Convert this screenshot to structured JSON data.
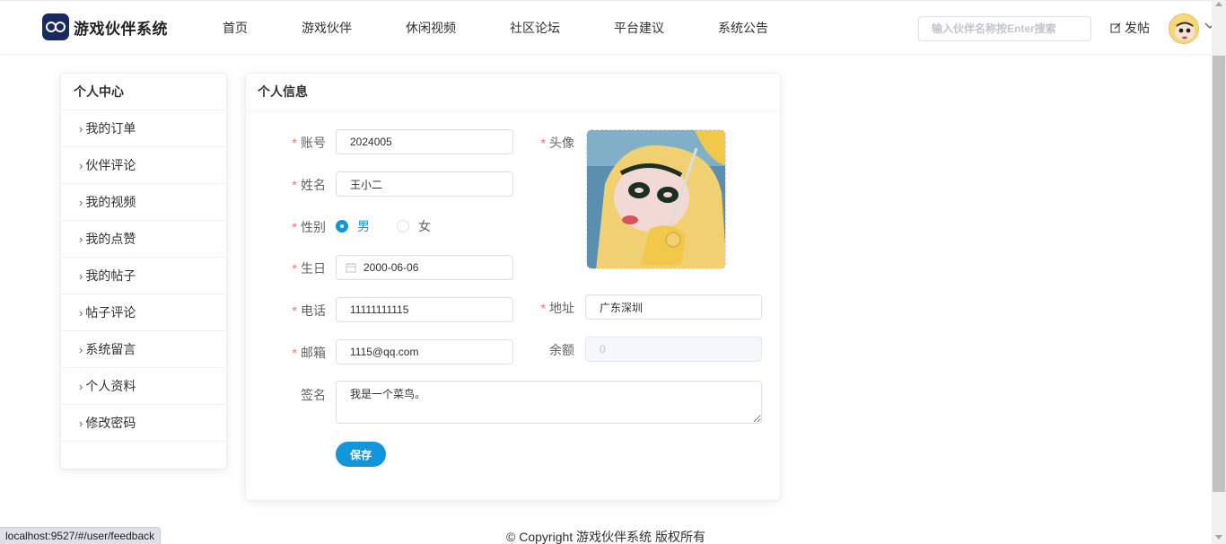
{
  "app": {
    "name": "游戏伙伴系统"
  },
  "nav": {
    "items": [
      "首页",
      "游戏伙伴",
      "休闲视频",
      "社区论坛",
      "平台建议",
      "系统公告"
    ]
  },
  "header": {
    "search_placeholder": "输入伙伴名称按Enter搜索",
    "post_label": "发帖"
  },
  "sidebar": {
    "title": "个人中心",
    "items": [
      "我的订单",
      "伙伴评论",
      "我的视频",
      "我的点赞",
      "我的帖子",
      "帖子评论",
      "系统留言",
      "个人资料",
      "修改密码"
    ]
  },
  "profile": {
    "title": "个人信息",
    "account_label": "账号",
    "account_value": "2024005",
    "name_label": "姓名",
    "name_value": "王小二",
    "gender_label": "性别",
    "gender_male": "男",
    "gender_female": "女",
    "gender_selected": "男",
    "birthday_label": "生日",
    "birthday_value": "2000-06-06",
    "phone_label": "电话",
    "phone_value": "11111111115",
    "email_label": "邮箱",
    "email_value": "1115@qq.com",
    "avatar_label": "头像",
    "address_label": "地址",
    "address_value": "广东深圳",
    "balance_label": "余额",
    "balance_value": "0",
    "signature_label": "签名",
    "signature_value": "我是一个菜鸟。",
    "save_label": "保存"
  },
  "footer": {
    "copyright": "© Copyright 游戏伙伴系统 版权所有"
  },
  "status_bar": {
    "url": "localhost:9527/#/user/feedback"
  },
  "colors": {
    "primary": "#1296db",
    "required": "#f56c6c"
  }
}
